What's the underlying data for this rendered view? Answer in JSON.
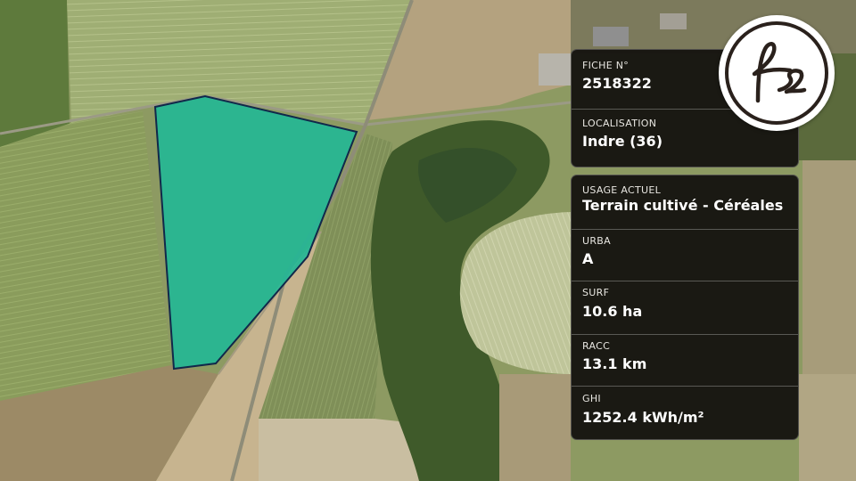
{
  "map": {
    "parcel_color": "#1fb896",
    "parcel_outline": "#11284a"
  },
  "logo": {
    "icon": "fs-monogram-logo"
  },
  "card_top": {
    "fiche_label": "FICHE N°",
    "fiche_value": "2518322",
    "localisation_label": "LOCALISATION",
    "localisation_value": "Indre (36)"
  },
  "card_bottom": {
    "usage_label": "USAGE ACTUEL",
    "usage_value": "Terrain cultivé - Céréales",
    "urba_label": "URBA",
    "urba_value": "A",
    "surf_label": "SURF",
    "surf_value": "10.6 ha",
    "racc_label": "RACC",
    "racc_value": "13.1 km",
    "ghi_label": "GHI",
    "ghi_value": "1252.4 kWh/m²"
  }
}
